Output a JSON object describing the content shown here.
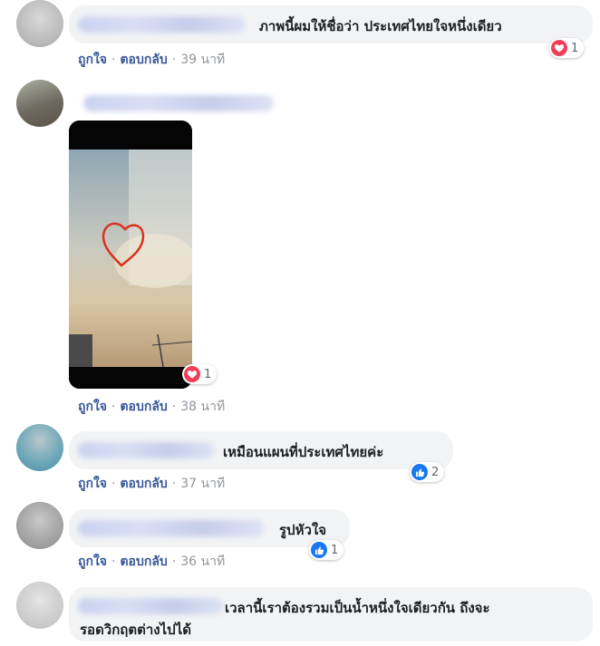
{
  "comments": [
    {
      "text": "ภาพนี้ผมให้ชื่อว่า ประเทศไทยใจหนึ่งเดียว",
      "reaction": "heart-icon",
      "reaction_count": "1",
      "time": "39 นาที"
    },
    {
      "text": "",
      "reaction": "heart-icon",
      "reaction_count": "1",
      "time": "38 นาที"
    },
    {
      "text": "เหมือนแผนที่ประเทศไทยค่ะ",
      "reaction": "like-icon",
      "reaction_count": "2",
      "time": "37 นาที"
    },
    {
      "text": "รูปหัวใจ",
      "reaction": "like-icon",
      "reaction_count": "1",
      "time": "36 นาที"
    },
    {
      "text_line1": "เวลานี้เราต้องรวมเป็นน้ำหนึ่งใจเดียวกัน ถึงจะ",
      "text_line2": "รอดวิกฤตต่างไปได้"
    }
  ],
  "actions": {
    "like": "ถูกใจ",
    "reply": "ตอบกลับ",
    "sep": "·"
  },
  "colors": {
    "link": "#385898",
    "bubble": "#f2f3f5",
    "heart": "#f33e58",
    "like": "#1877f2"
  }
}
